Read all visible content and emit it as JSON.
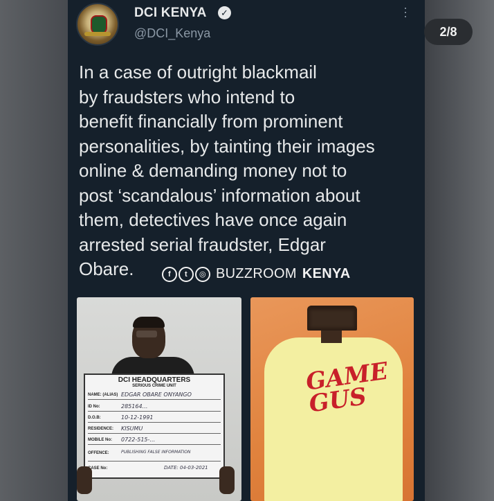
{
  "tweet": {
    "author_name": "DCI KENYA",
    "handle": "@DCI_Kenya",
    "text_lines": [
      "In a case of outright blackmail",
      "by fraudsters who intend to",
      "benefit financially from prominent",
      "personalities, by tainting their images",
      "online & demanding money not to",
      "post ‘scandalous’ information about",
      "them, detectives have once again",
      "arrested serial fraudster, Edgar",
      "Obare."
    ]
  },
  "watermark": {
    "icons": [
      "facebook-icon",
      "twitter-icon",
      "instagram-icon"
    ],
    "text": "BUZZROOM",
    "strong": "KENYA"
  },
  "board": {
    "title": "DCI HEADQUARTERS",
    "subtitle": "SERIOUS CRIME UNIT",
    "rows": [
      {
        "label": "NAME: (ALIAS)",
        "value": "EDGAR OBARE ONYANGO"
      },
      {
        "label": "ID No:",
        "value": "285164…"
      },
      {
        "label": "D.O.B:",
        "value": "10-12-1991"
      },
      {
        "label": "RESIDENCE:",
        "value": "KISUMU"
      },
      {
        "label": "MOBILE No:",
        "value": "0722-515-…"
      },
      {
        "label": "OFFENCE:",
        "value": "PUBLISHING FALSE INFORMATION"
      },
      {
        "label": "CASE No:",
        "value": "DATE: 04-03-2021"
      }
    ]
  },
  "shirt_text": "GAME GUS",
  "pager": {
    "label": "2/8"
  }
}
